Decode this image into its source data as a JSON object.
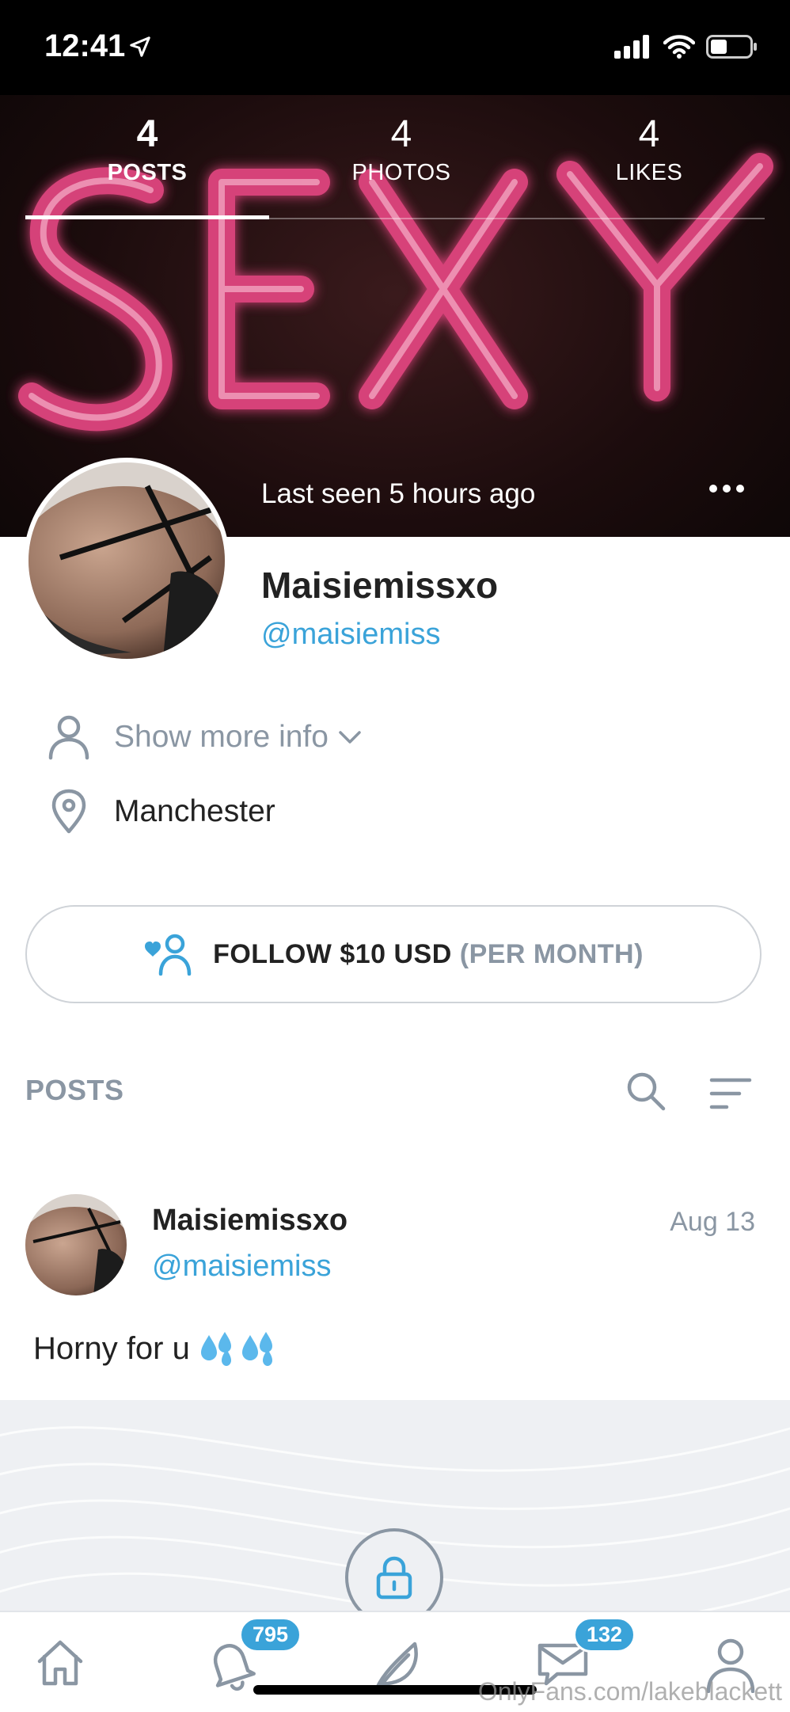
{
  "status_bar": {
    "time": "12:41"
  },
  "tabs": [
    {
      "count": "4",
      "label": "POSTS",
      "active": true
    },
    {
      "count": "4",
      "label": "PHOTOS",
      "active": false
    },
    {
      "count": "4",
      "label": "LIKES",
      "active": false
    }
  ],
  "cover": {
    "neon_text": "SEXY",
    "last_seen": "Last seen 5 hours ago"
  },
  "profile": {
    "name": "Maisiemissxo",
    "handle": "@maisiemiss",
    "show_more": "Show more info",
    "location": "Manchester"
  },
  "follow": {
    "label": "FOLLOW $10 USD",
    "sub": "(PER MONTH)"
  },
  "posts_section": {
    "title": "POSTS"
  },
  "post": {
    "name": "Maisiemissxo",
    "handle": "@maisiemiss",
    "date": "Aug 13",
    "text": "Horny for u"
  },
  "nav": {
    "notifications_badge": "795",
    "messages_badge": "132"
  },
  "watermark": "OnlyFans.com/lakeblackett",
  "colors": {
    "accent": "#3aa3d9",
    "muted": "#8a96a3",
    "neon": "#e0457f"
  }
}
